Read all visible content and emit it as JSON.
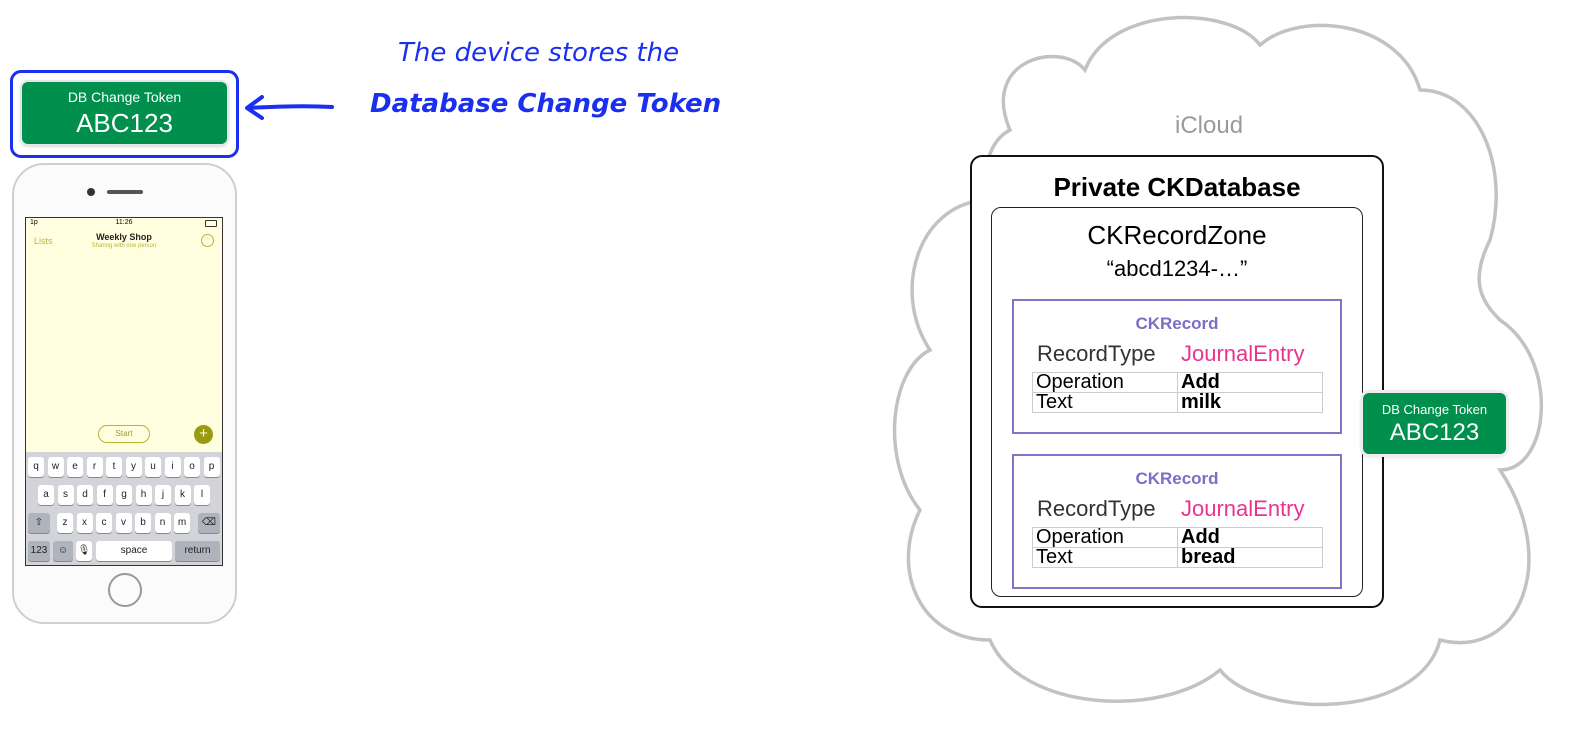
{
  "device_token": {
    "label": "DB Change Token",
    "value": "ABC123"
  },
  "annotation": {
    "line1": "The device stores the",
    "line2": "Database Change Token"
  },
  "phone": {
    "status_time": "11:26",
    "status_carrier": "1p",
    "back_label": "Lists",
    "title": "Weekly Shop",
    "subtitle": "Sharing with one person",
    "start_button": "Start",
    "keyboard": {
      "row1": [
        "q",
        "w",
        "e",
        "r",
        "t",
        "y",
        "u",
        "i",
        "o",
        "p"
      ],
      "row2": [
        "a",
        "s",
        "d",
        "f",
        "g",
        "h",
        "j",
        "k",
        "l"
      ],
      "row3": [
        "z",
        "x",
        "c",
        "v",
        "b",
        "n",
        "m"
      ],
      "key_123": "123",
      "space": "space",
      "return": "return"
    }
  },
  "cloud": {
    "label": "iCloud",
    "database": {
      "title": "Private CKDatabase",
      "zone": {
        "title": "CKRecordZone",
        "name": "“abcd1234-…”",
        "records": [
          {
            "title": "CKRecord",
            "type_label": "RecordType",
            "type_value": "JournalEntry",
            "fields": [
              [
                "Operation",
                "Add"
              ],
              [
                "Text",
                "milk"
              ]
            ]
          },
          {
            "title": "CKRecord",
            "type_label": "RecordType",
            "type_value": "JournalEntry",
            "fields": [
              [
                "Operation",
                "Add"
              ],
              [
                "Text",
                "bread"
              ]
            ]
          }
        ]
      }
    },
    "token": {
      "label": "DB Change Token",
      "value": "ABC123"
    }
  },
  "colors": {
    "token_green": "#008f4c",
    "annotation_blue": "#1a2ff0",
    "record_purple": "#7b6fc4",
    "record_type_pink": "#e8348f"
  }
}
